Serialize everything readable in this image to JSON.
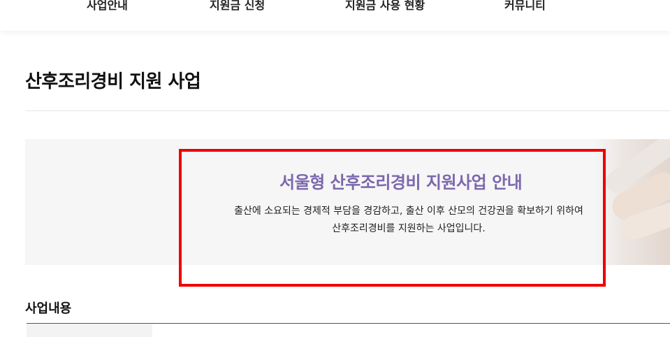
{
  "nav": {
    "items": [
      {
        "label": "사업안내"
      },
      {
        "label": "지원금 신청"
      },
      {
        "label": "지원금 사용 현황"
      },
      {
        "label": "커뮤니티"
      }
    ]
  },
  "page": {
    "title": "산후조리경비 지원 사업"
  },
  "banner": {
    "heading": "서울형 산후조리경비 지원사업 안내",
    "description_line1": "출산에 소요되는 경제적 부담을 경감하고, 출산 이후 산모의 건강권을 확보하기 위하여",
    "description_line2": "산후조리경비를 지원하는 사업입니다.",
    "heading_color": "#7b68ac"
  },
  "section": {
    "title": "사업내용"
  },
  "colors": {
    "highlight": "#ee0000",
    "banner_bg": "#f6f6f7"
  }
}
